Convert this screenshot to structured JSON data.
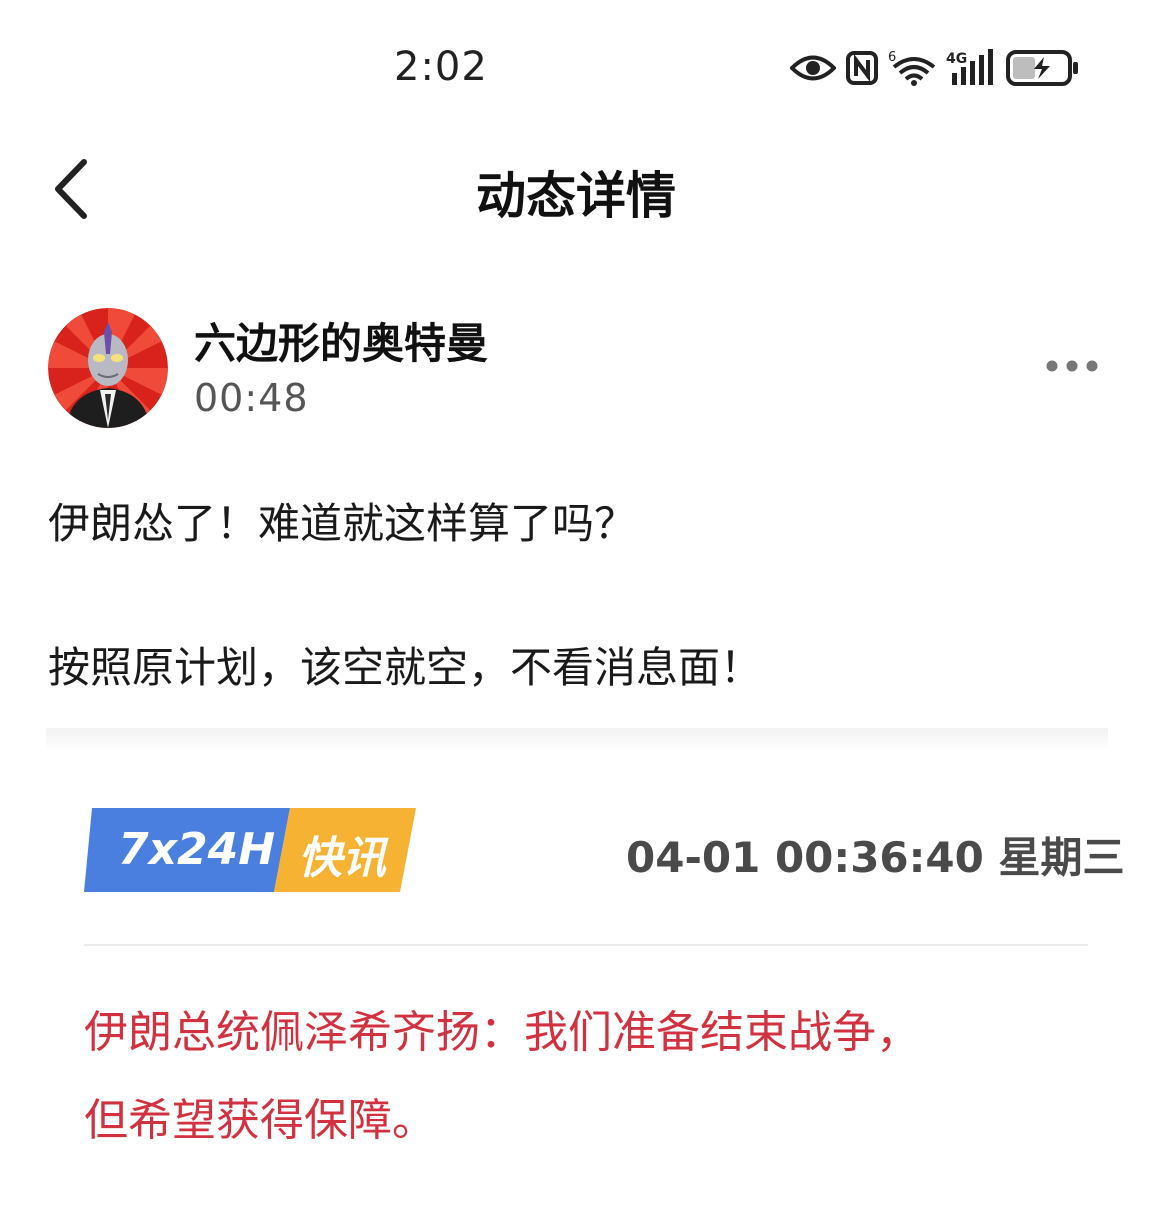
{
  "status_bar": {
    "time": "2:02",
    "icons": [
      "eye-comfort-icon",
      "nfc-icon",
      "wifi-6-icon",
      "signal-4g-icon",
      "battery-charging-icon"
    ],
    "wifi_label": "6",
    "network_label": "4G"
  },
  "header": {
    "back_icon": "chevron-left-icon",
    "title": "动态详情"
  },
  "author": {
    "name": "六边形的奥特曼",
    "time": "00:48",
    "more_icon": "more-dots-icon"
  },
  "post": {
    "line1": "伊朗怂了！难道就这样算了吗？",
    "line2": "按照原计划，该空就空，不看消息面！"
  },
  "embed": {
    "badge_left": "7x24H",
    "badge_right": "快讯",
    "datetime": "04-01 00:36:40 星期三",
    "headline_line1": "伊朗总统佩泽希齐扬：我们准备结束战争，",
    "headline_line2": "但希望获得保障。"
  },
  "colors": {
    "badge_blue": "#4a7fe0",
    "badge_yellow": "#f5b233",
    "headline_red": "#d2323f",
    "avatar_red": "#d8231c"
  }
}
